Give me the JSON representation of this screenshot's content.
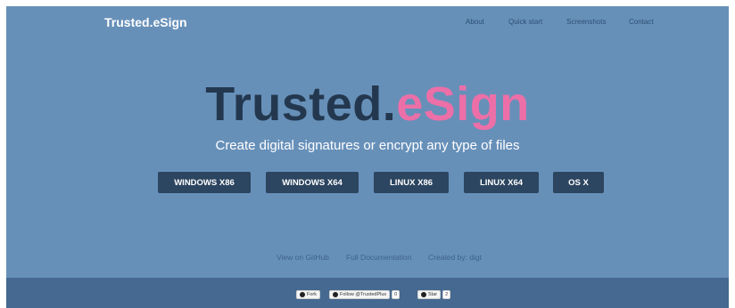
{
  "header": {
    "brand": "Trusted.eSign",
    "nav": [
      "About",
      "Quick start",
      "Screenshots",
      "Contact"
    ]
  },
  "hero": {
    "title_part1": "Trusted.",
    "title_part2": "eSign",
    "tagline": "Create digital signatures or encrypt any type of files"
  },
  "downloads": [
    "WINDOWS X86",
    "WINDOWS X64",
    "LINUX X86",
    "LINUX X64",
    "OS X"
  ],
  "links": [
    "View on GitHub",
    "Full Documentation",
    "Created by: digt"
  ],
  "footer": {
    "fork_label": "Fork",
    "follow_label": "Follow @TrustedPlus",
    "follow_count": "0",
    "star_label": "Star",
    "star_count": "2"
  },
  "colors": {
    "page_bg": "#6790b9",
    "footer_bg": "#456990",
    "button_bg": "#2c4560",
    "title_dark": "#23384f",
    "title_pink": "#ec6fa8"
  }
}
